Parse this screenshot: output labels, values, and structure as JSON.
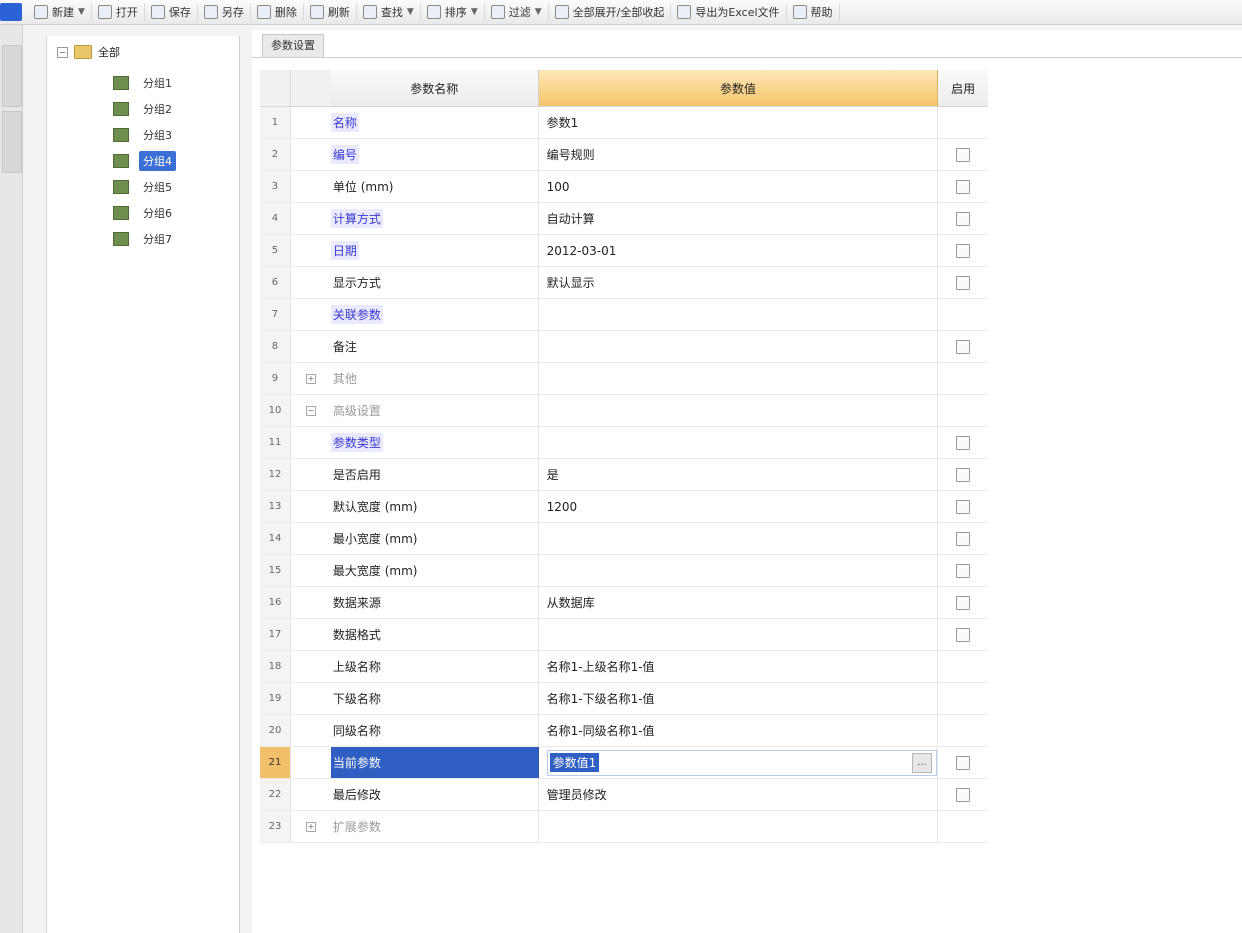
{
  "toolbar": {
    "items": [
      {
        "label": "新建",
        "caret": true
      },
      {
        "label": "打开",
        "caret": false
      },
      {
        "label": "保存",
        "caret": false
      },
      {
        "label": "另存",
        "caret": false
      },
      {
        "label": "删除",
        "caret": false
      },
      {
        "label": "刷新",
        "caret": false
      },
      {
        "label": "查找",
        "caret": true
      },
      {
        "label": "排序",
        "caret": true
      },
      {
        "label": "过滤",
        "caret": true
      },
      {
        "label": "全部展开/全部收起",
        "caret": false
      },
      {
        "label": "导出为Excel文件",
        "caret": false
      },
      {
        "label": "帮助",
        "caret": false
      }
    ]
  },
  "tree": {
    "root": {
      "label": "全部",
      "expander": "−"
    },
    "children": [
      "分组1",
      "分组2",
      "分组3",
      "分组4",
      "分组5",
      "分组6",
      "分组7"
    ],
    "active_index": 3
  },
  "main": {
    "tab_label": "参数设置",
    "columns": {
      "name": "参数名称",
      "value": "参数值",
      "flag": "启用"
    }
  },
  "rows": [
    {
      "num": "1",
      "name": "名称",
      "value": "参数1",
      "style": "link",
      "indent": 1,
      "check": false,
      "expander": ""
    },
    {
      "num": "2",
      "name": "编号",
      "value": "编号规则",
      "style": "link",
      "indent": 1,
      "check": true,
      "expander": ""
    },
    {
      "num": "3",
      "name": "单位 (mm)",
      "value": "100",
      "style": "",
      "indent": 1,
      "check": true,
      "expander": ""
    },
    {
      "num": "4",
      "name": "计算方式",
      "value": "自动计算",
      "style": "link",
      "indent": 1,
      "check": true,
      "expander": ""
    },
    {
      "num": "5",
      "name": "日期",
      "value": "2012-03-01",
      "style": "link",
      "indent": 1,
      "check": true,
      "expander": ""
    },
    {
      "num": "6",
      "name": "显示方式",
      "value": "默认显示",
      "style": "",
      "indent": 1,
      "check": true,
      "expander": ""
    },
    {
      "num": "7",
      "name": "关联参数",
      "value": "",
      "style": "link",
      "indent": 1,
      "check": false,
      "expander": ""
    },
    {
      "num": "8",
      "name": "备注",
      "value": "",
      "style": "",
      "indent": 1,
      "check": true,
      "expander": ""
    },
    {
      "num": "9",
      "name": "其他",
      "value": "",
      "style": "muted",
      "indent": 1,
      "check": false,
      "expander": "+"
    },
    {
      "num": "10",
      "name": "高级设置",
      "value": "",
      "style": "muted",
      "indent": 1,
      "check": false,
      "expander": "−"
    },
    {
      "num": "11",
      "name": "参数类型",
      "value": "",
      "style": "link",
      "indent": 2,
      "check": true,
      "expander": ""
    },
    {
      "num": "12",
      "name": "是否启用",
      "value": "是",
      "style": "",
      "indent": 2,
      "check": true,
      "expander": ""
    },
    {
      "num": "13",
      "name": "默认宽度 (mm)",
      "value": "1200",
      "style": "",
      "indent": 2,
      "check": true,
      "expander": ""
    },
    {
      "num": "14",
      "name": "最小宽度 (mm)",
      "value": "",
      "style": "",
      "indent": 2,
      "check": true,
      "expander": ""
    },
    {
      "num": "15",
      "name": "最大宽度 (mm)",
      "value": "",
      "style": "",
      "indent": 2,
      "check": true,
      "expander": ""
    },
    {
      "num": "16",
      "name": "数据来源",
      "value": "从数据库",
      "style": "",
      "indent": 2,
      "check": true,
      "expander": ""
    },
    {
      "num": "17",
      "name": "数据格式",
      "value": "",
      "style": "",
      "indent": 2,
      "check": true,
      "expander": ""
    },
    {
      "num": "18",
      "name": "上级名称",
      "value": "名称1-上级名称1-值",
      "style": "",
      "indent": 2,
      "check": false,
      "expander": ""
    },
    {
      "num": "19",
      "name": "下级名称",
      "value": "名称1-下级名称1-值",
      "style": "",
      "indent": 2,
      "check": false,
      "expander": ""
    },
    {
      "num": "20",
      "name": "同级名称",
      "value": "名称1-同级名称1-值",
      "style": "",
      "indent": 2,
      "check": false,
      "expander": ""
    },
    {
      "num": "21",
      "name": "当前参数",
      "value": "参数值1",
      "style": "",
      "indent": 2,
      "check": true,
      "expander": "",
      "selected": true,
      "edit_button": "..."
    },
    {
      "num": "22",
      "name": "最后修改",
      "value": "管理员修改",
      "style": "",
      "indent": 2,
      "check": true,
      "expander": ""
    },
    {
      "num": "23",
      "name": "扩展参数",
      "value": "",
      "style": "muted",
      "indent": 1,
      "check": false,
      "expander": "+"
    }
  ]
}
